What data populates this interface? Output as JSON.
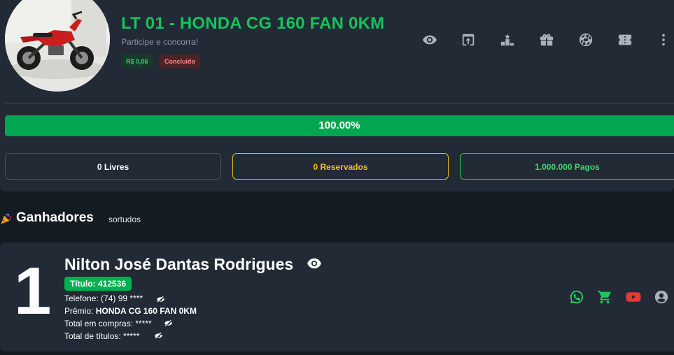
{
  "raffle": {
    "title": "LT 01 - HONDA CG 160 FAN 0KM",
    "subtitle": "Participe e concorra!",
    "price_badge": "R$ 0,06",
    "status_badge": "Concluído"
  },
  "toolbar": {
    "icons": [
      "eye-icon",
      "share-icon",
      "podium-icon",
      "gift-icon",
      "aperture-icon",
      "ticket-icon",
      "more-vert-icon"
    ]
  },
  "progress": {
    "value": 1.0,
    "label": "100.00%"
  },
  "stats": {
    "free": "0 Livres",
    "reserved": "0 Reservados",
    "paid": "1.000.000 Pagos"
  },
  "winners_section": {
    "title": "Ganhadores",
    "subtitle": "sortudos"
  },
  "winner": {
    "rank": "1",
    "name": "Nilton José Dantas Rodrigues",
    "ticket": "Título: 412536",
    "phone": "Telefone: (74) 99 ****",
    "prize_label": "Prêmio:",
    "prize_value": "HONDA CG 160 FAN 0KM",
    "total_purchases": "Total em compras: *****",
    "total_titles": "Total de títulos: *****"
  },
  "colors": {
    "accent_green": "#16c35a",
    "progress_green": "#00a651",
    "reserved_yellow": "#e9b824",
    "whatsapp": "#25d366",
    "youtube": "#e53935"
  }
}
